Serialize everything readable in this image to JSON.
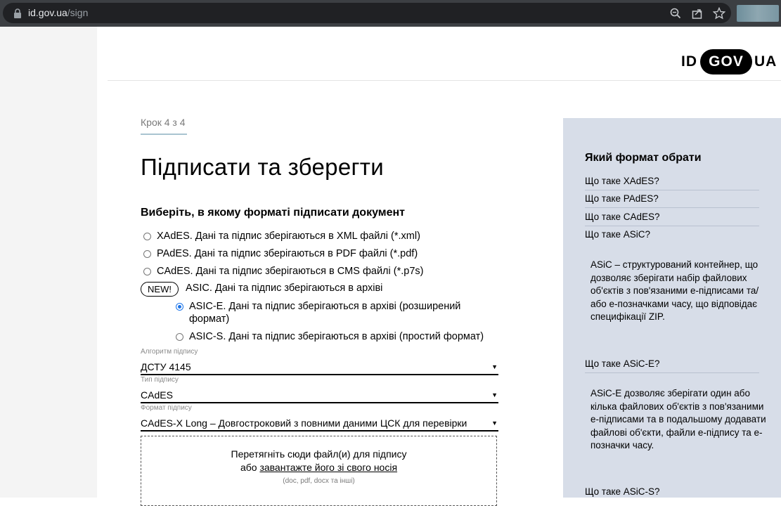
{
  "browser": {
    "url_host": "id.gov.ua",
    "url_path": "/sign"
  },
  "logo": {
    "id": "ID",
    "gov": "GOV",
    "ua": "UA"
  },
  "main": {
    "step": "Крок 4 з 4",
    "title": "Підписати та зберегти",
    "format_question": "Виберіть, в якому форматі підписати документ",
    "options": [
      {
        "label": "XAdES. Дані та підпис зберігаються в XML файлі (*.xml)",
        "checked": false
      },
      {
        "label": "PAdES. Дані та підпис зберігаються в PDF файлі (*.pdf)",
        "checked": false
      },
      {
        "label": "CAdES. Дані та підпис зберігаються в CMS файлі (*.p7s)",
        "checked": false
      }
    ],
    "new_badge": "NEW!",
    "asic_label": "ASIC. Дані та підпис зберігаються в архіві",
    "asic_options": [
      {
        "label": "ASIC-E. Дані та підпис зберігаються в архіві (розширений формат)",
        "checked": true
      },
      {
        "label": "ASIC-S. Дані та підпис зберігаються в архіві (простий формат)",
        "checked": false
      }
    ],
    "fields": {
      "algorithm": {
        "label": "Алгоритм підпису",
        "value": "ДСТУ 4145"
      },
      "type": {
        "label": "Тип підпису",
        "value": "CAdES"
      },
      "format": {
        "label": "Формат підпису",
        "value": "CAdES-X Long – Довгостроковий з повними даними ЦСК для перевірки"
      }
    },
    "dropzone": {
      "line1": "Перетягніть сюди файл(и) для підпису",
      "line2_prefix": "або",
      "line2_link": "завантажте його зі свого носія",
      "hint": "(doc, pdf, docx та інші)"
    }
  },
  "side": {
    "title": "Який формат обрати",
    "links": [
      "Що таке XAdES?",
      "Що таке PAdES?",
      "Що таке CAdES?",
      "Що таке ASiC?"
    ],
    "asic_desc": "ASiC – структурований контейнер, що дозволяє зберігати набір файлових об'єктів з пов'язаними е-підписами та/або е-позначками часу, що відповідає специфікації ZIP.",
    "asic_e_title": "Що таке ASiC-E?",
    "asic_e_desc": "ASiC-E дозволяє зберігати один або кілька файлових об'єктів з пов'язаними е-підписами та в подальшому додавати файлові об'єкти, файли е-підпису та е-позначки часу.",
    "asic_s_title": "Що таке ASiC-S?"
  },
  "colors": {
    "side_panel_bg": "#d7dde8",
    "radio_checked": "#1a73e8",
    "browser_bar": "#3c3f43"
  }
}
